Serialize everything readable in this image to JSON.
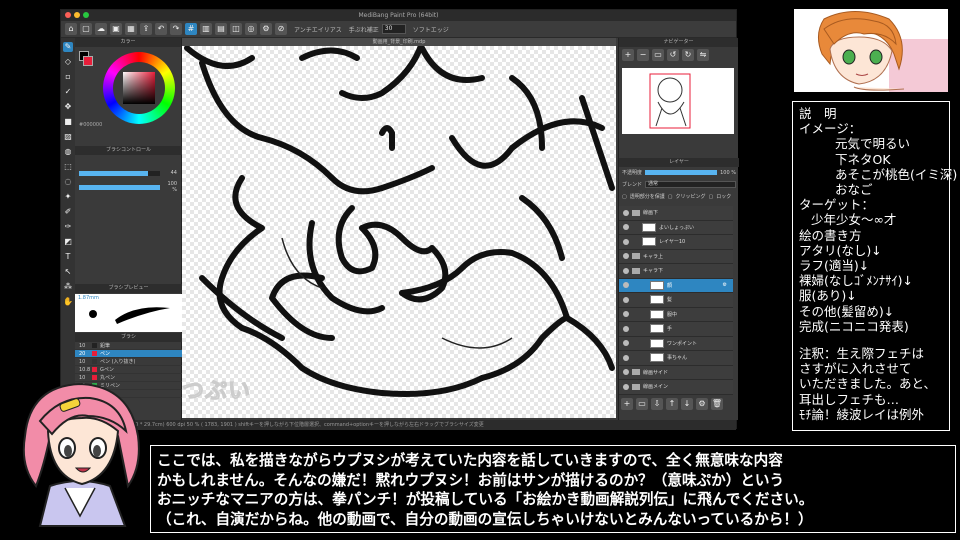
{
  "app": {
    "title": "MediBang Paint Pro (64bit)",
    "canvas_tab": "動画用_背景_印刷.mdp",
    "toolbar": {
      "antialias_label": "アンチエイリアス",
      "hand_label": "手ぶれ補正",
      "hand_value": "30",
      "soft_edge_label": "ソフトエッジ"
    },
    "status": "2480 * 3508 pixel   (21.0 * 29.7cm)   600 dpi   50 %   ( 1783, 1901 )   shiftキーを押しながら下位階層選択、command+optionキーを押しながら左右ドラッグでブラシサイズ変更",
    "watermark": "つぷい"
  },
  "left_panel": {
    "color_title": "カラー",
    "hex": "#000000",
    "brush_control_title": "ブラシコントロール",
    "size_value": "44",
    "size_level": 0.85,
    "opacity_value": "100 %",
    "opacity_level": 1.0,
    "brush_preview_title": "ブラシプレビュー",
    "brush_preview_size": "1.87mm",
    "brush_title": "ブラシ",
    "brushes": [
      {
        "size": "10",
        "name": "鉛筆",
        "color": "#222222",
        "selected": false
      },
      {
        "size": "20",
        "name": "ペン",
        "color": "#e81e3a",
        "selected": true
      },
      {
        "size": "10",
        "name": "ペン (入り抜き)",
        "color": "#333333",
        "selected": false
      },
      {
        "size": "10.8",
        "name": "Gペン",
        "color": "#e81e3a",
        "selected": false
      },
      {
        "size": "10",
        "name": "丸ペン",
        "color": "#e81e3a",
        "selected": false
      },
      {
        "size": "10",
        "name": "ミリペン",
        "color": "#2ea84a",
        "selected": false
      },
      {
        "size": "",
        "name": "水彩",
        "color": "#666666",
        "selected": false
      }
    ]
  },
  "right_panel": {
    "navigator_title": "ナビゲーター",
    "layer_title": "レイヤー",
    "opacity_label": "不透明度",
    "opacity_value": "100 %",
    "blend_label": "ブレンド",
    "blend_value": "通常",
    "protect_label": "透明部分を保護",
    "clipping_label": "クリッピング",
    "lock_label": "ロック",
    "layers": [
      {
        "name": "線画下",
        "kind": "folder",
        "indent": 0,
        "selected": false
      },
      {
        "name": "よいしょっぷい",
        "kind": "line",
        "indent": 1,
        "selected": false
      },
      {
        "name": "レイヤー10",
        "kind": "layer",
        "indent": 1,
        "selected": false
      },
      {
        "name": "キャラ上",
        "kind": "folder",
        "indent": 0,
        "selected": false
      },
      {
        "name": "キャラ下",
        "kind": "folder",
        "indent": 0,
        "selected": false
      },
      {
        "name": "顔",
        "kind": "layer",
        "indent": 2,
        "selected": true
      },
      {
        "name": "髪",
        "kind": "layer",
        "indent": 2,
        "selected": false
      },
      {
        "name": "服中",
        "kind": "layer",
        "indent": 2,
        "selected": false
      },
      {
        "name": "手",
        "kind": "layer",
        "indent": 2,
        "selected": false
      },
      {
        "name": "ワンポイント",
        "kind": "layer",
        "indent": 2,
        "selected": false
      },
      {
        "name": "事ちゃん",
        "kind": "layer",
        "indent": 2,
        "selected": false
      },
      {
        "name": "線画サイド",
        "kind": "folder",
        "indent": 0,
        "selected": false
      },
      {
        "name": "線画メイン",
        "kind": "folder",
        "indent": 0,
        "selected": false
      }
    ]
  },
  "explain": {
    "lines": [
      {
        "text": "説　明",
        "indent": 0
      },
      {
        "text": "イメージ：",
        "indent": 0
      },
      {
        "text": "元気で明るい",
        "indent": 2
      },
      {
        "text": "下ネタOK",
        "indent": 2
      },
      {
        "text": "あそこが桃色(イミ深)",
        "indent": 2
      },
      {
        "text": "おなご",
        "indent": 2
      },
      {
        "text": "ターゲット：",
        "indent": 0
      },
      {
        "text": "少年少女～∞才",
        "indent": 1
      },
      {
        "text": "絵の書き方",
        "indent": 0
      },
      {
        "text": "アタリ(なし)↓",
        "indent": 0
      },
      {
        "text": "ラフ(適当)↓",
        "indent": 0
      },
      {
        "text": "裸婦(なしｺﾞﾒﾝﾅｻｲ)↓",
        "indent": 0
      },
      {
        "text": "服(あり)↓",
        "indent": 0
      },
      {
        "text": "その他(髪留め)↓",
        "indent": 0
      },
      {
        "text": "完成(ニコニコ発表)",
        "indent": 0
      },
      {
        "text": "",
        "indent": 0
      },
      {
        "text": "注釈：生え際フェチは",
        "indent": 0
      },
      {
        "text": "さすがに入れさせて",
        "indent": 0
      },
      {
        "text": "いただきました。あと、",
        "indent": 0
      },
      {
        "text": "耳出しフェチも…",
        "indent": 0
      },
      {
        "text": "ﾓﾁ論！綾波レイは例外",
        "indent": 0
      }
    ]
  },
  "subtitle": {
    "lines": [
      "ここでは、私を描きながらウプヌシが考えていた内容を話していきますので、全く無意味な内容",
      "かもしれません。そんなの嫌だ！黙れウプヌシ！お前はサンが描けるのか？（意味ぷか）という",
      "おニッチなマニアの方は、拳パンチ！が投稿している「お絵かき動画解説列伝」に飛んでください。",
      "（これ、自演だからね。他の動画で、自分の動画の宣伝しちゃいけないとみんないっているから！）"
    ]
  }
}
